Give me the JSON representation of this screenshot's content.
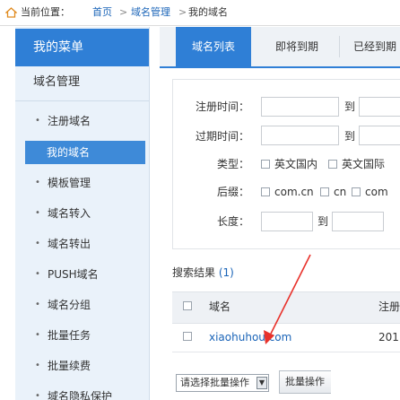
{
  "breadcrumb": {
    "prefix": "当前位置：",
    "home": "首页",
    "separator": ">",
    "section": "域名管理",
    "current": "我的域名"
  },
  "sidebar": {
    "header": "我的菜单",
    "group": "域名管理",
    "bullet": "•",
    "items": [
      {
        "label": "注册域名"
      },
      {
        "label": "我的域名"
      },
      {
        "label": "模板管理"
      },
      {
        "label": "域名转入"
      },
      {
        "label": "域名转出"
      },
      {
        "label": "PUSH域名"
      },
      {
        "label": "域名分组"
      },
      {
        "label": "批量任务"
      },
      {
        "label": "批量续费"
      },
      {
        "label": "域名隐私保护"
      }
    ]
  },
  "tabs": [
    {
      "label": "域名列表"
    },
    {
      "label": "即将到期"
    },
    {
      "label": "已经到期"
    }
  ],
  "search_form": {
    "reg_time_label": "注册时间：",
    "expire_time_label": "过期时间：",
    "type_label": "类型：",
    "suffix_label": "后缀：",
    "length_label": "长度：",
    "to_label": "到",
    "types": [
      "英文国内",
      "英文国际"
    ],
    "suffixes": [
      "com.cn",
      "cn",
      "com"
    ]
  },
  "results": {
    "title": "搜索结果",
    "count": "(1)",
    "columns": {
      "domain": "域名",
      "reg": "注册"
    },
    "rows": [
      {
        "domain": "xiaohuhou.com",
        "reg": "201"
      }
    ]
  },
  "bottom": {
    "batch_select": "请选择批量操作",
    "batch_button": "批量操作"
  },
  "colors": {
    "accent": "#2f7fd6",
    "link": "#1a64b8",
    "arrow": "#e8322b"
  }
}
